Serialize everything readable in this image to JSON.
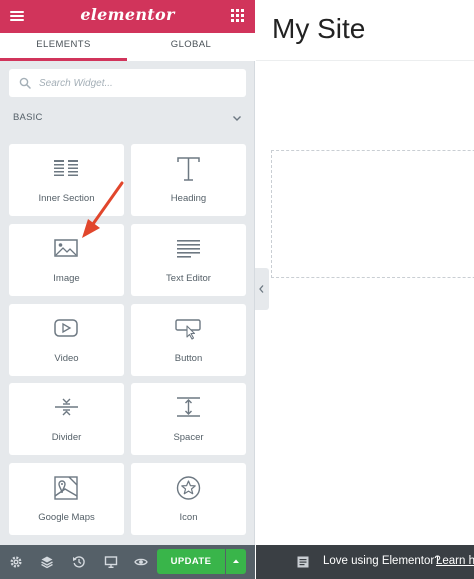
{
  "panel": {
    "header": {
      "logo_text": "elementor",
      "brand_color": "#d1345b"
    },
    "tabs": [
      {
        "label": "ELEMENTS",
        "active": true
      },
      {
        "label": "GLOBAL",
        "active": false
      }
    ],
    "search": {
      "placeholder": "Search Widget...",
      "value": ""
    },
    "category": {
      "label": "BASIC",
      "expanded": true
    },
    "widgets": [
      {
        "label": "Inner Section",
        "icon": "inner-section-icon"
      },
      {
        "label": "Heading",
        "icon": "heading-icon"
      },
      {
        "label": "Image",
        "icon": "image-icon"
      },
      {
        "label": "Text Editor",
        "icon": "text-editor-icon"
      },
      {
        "label": "Video",
        "icon": "video-icon"
      },
      {
        "label": "Button",
        "icon": "button-icon"
      },
      {
        "label": "Divider",
        "icon": "divider-icon"
      },
      {
        "label": "Spacer",
        "icon": "spacer-icon"
      },
      {
        "label": "Google Maps",
        "icon": "google-maps-icon"
      },
      {
        "label": "Icon",
        "icon": "icon-widget-icon"
      }
    ],
    "annotation": {
      "arrow_color": "#e1462c"
    }
  },
  "footer": {
    "tools": [
      "settings-icon",
      "navigator-icon",
      "history-icon",
      "responsive-icon",
      "preview-icon"
    ],
    "update_label": "UPDATE",
    "update_color": "#39b54a"
  },
  "preview": {
    "site_title": "My Site",
    "notice_text": "Love using Elementor?",
    "notice_link": "Learn h"
  }
}
